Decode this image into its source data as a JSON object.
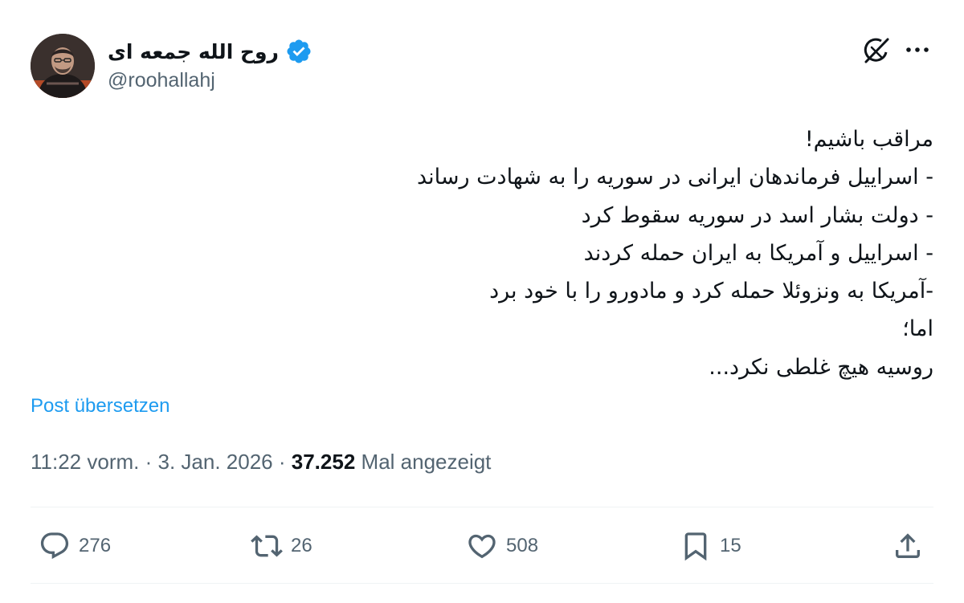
{
  "author": {
    "display_name": "روح الله جمعه ای",
    "handle": "@roohallahj",
    "verified": true,
    "verified_color": "#1d9bf0"
  },
  "tweet": {
    "lines": [
      "مراقب باشیم!",
      "- اسراییل فرماندهان ایرانی در سوریه را به شهادت رساند",
      "- دولت بشار اسد در سوریه سقوط کرد",
      "- اسراییل و آمریکا به ایران حمله کردند",
      "-آمریکا به ونزوئلا حمله کرد و مادورو را با خود برد",
      "اما؛",
      "روسیه هیچ غلطی نکرد..."
    ],
    "translate_label": "Post übersetzen"
  },
  "meta": {
    "time": "11:22 vorm.",
    "separator": "·",
    "date": "3. Jan. 2026",
    "views": "37.252",
    "views_label": "Mal angezeigt"
  },
  "actions": {
    "replies": "276",
    "reposts": "26",
    "likes": "508",
    "bookmarks": "15"
  },
  "colors": {
    "text": "#0f1419",
    "secondary": "#536471",
    "link": "#1d9bf0",
    "divider": "#eff3f4"
  },
  "icons": [
    "verified-badge-icon",
    "grok-icon",
    "more-icon",
    "reply-icon",
    "retweet-icon",
    "like-icon",
    "bookmark-icon",
    "share-icon"
  ]
}
